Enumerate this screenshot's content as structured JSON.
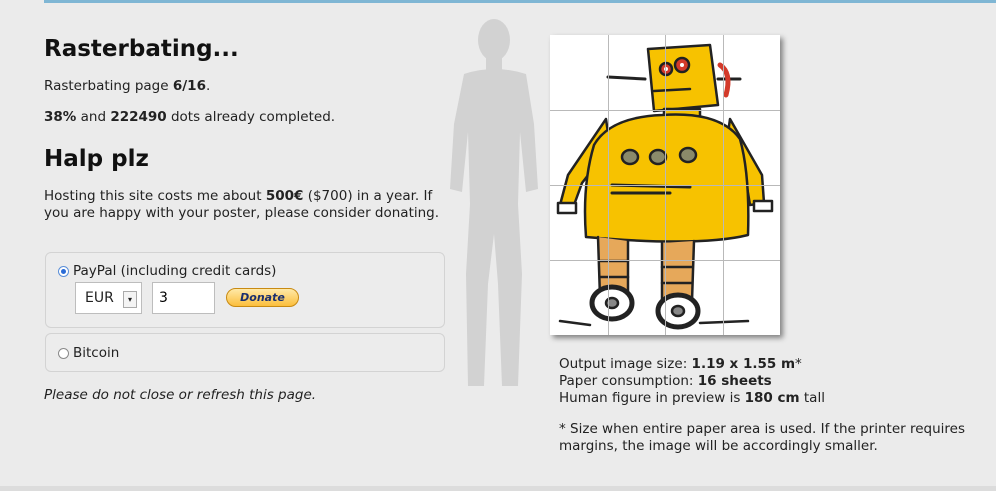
{
  "status": {
    "title": "Rasterbating...",
    "page_prefix": "Rasterbating page ",
    "page_value": "6/16",
    "page_suffix": ".",
    "percent": "38%",
    "mid_text": " and ",
    "dots": "222490",
    "dots_suffix": " dots already completed.",
    "progress_fraction": 0.38
  },
  "donate": {
    "title": "Halp plz",
    "cost_prefix": "Hosting this site costs me about ",
    "cost_value": "500€",
    "cost_suffix": " ($700) in a year. If you are happy with your poster, please consider donating.",
    "paypal_label": "PayPal (including credit cards)",
    "currency": "EUR",
    "amount": "3",
    "donate_button": "Donate",
    "bitcoin_label": "Bitcoin",
    "selected_method": "paypal"
  },
  "warning": "Please do not close or refresh this page.",
  "output": {
    "size_prefix": "Output image size: ",
    "size_value": "1.19 x 1.55 m",
    "size_suffix": "*",
    "paper_prefix": "Paper consumption: ",
    "paper_value": "16 sheets",
    "human_prefix": "Human figure in preview is ",
    "human_value": "180 cm",
    "human_suffix": " tall",
    "footnote": "* Size when entire paper area is used. If the printer requires margins, the image will be accordingly smaller."
  },
  "preview": {
    "grid_columns": 4,
    "grid_rows": 4,
    "robot_body_color": "#f7c200",
    "robot_accent_color": "#d33a2a",
    "grid_color": "#b9b9b9"
  }
}
